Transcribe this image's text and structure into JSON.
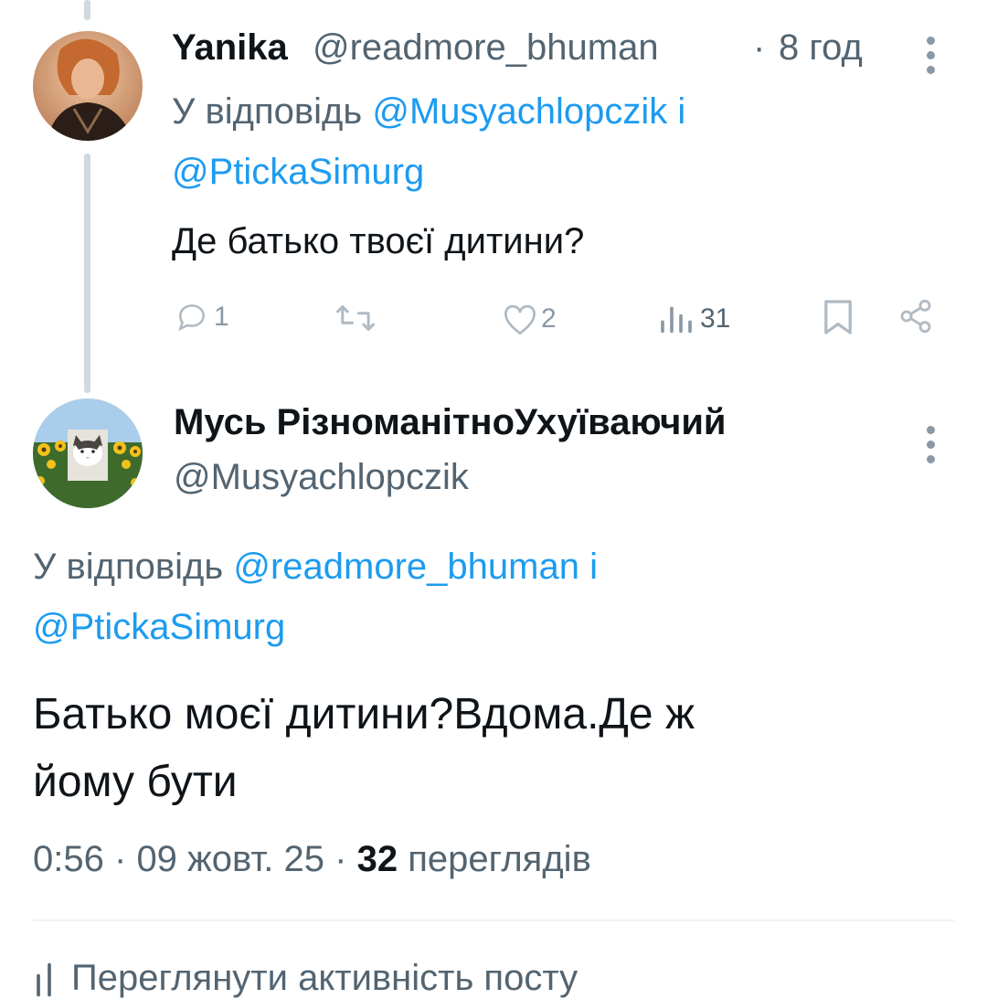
{
  "reply_tweet": {
    "display_name": "Yanika",
    "handle": "@readmore_bhuman",
    "separator": "·",
    "time_ago": "8 год",
    "reply_prefix": "У відповідь",
    "reply_to_1": "@Musyachlopczik",
    "reply_conj": "і",
    "reply_to_2": "@PtickaSimurg",
    "text": "Де батько твоєї дитини?",
    "actions": {
      "replies": "1",
      "retweets": "",
      "likes": "2",
      "views": "31"
    }
  },
  "main_tweet": {
    "display_name": "Мусь РізноманітноУхуїваючий",
    "handle": "@Musyachlopczik",
    "reply_prefix": "У відповідь",
    "reply_to_1": "@readmore_bhuman",
    "reply_conj": "і",
    "reply_to_2": "@PtickaSimurg",
    "text_line1": "Батько моєї дитини?Вдома.Де ж",
    "text_line2": "йому бути",
    "time": "0:56",
    "separator": "·",
    "date": "09 жовт. 25",
    "separator2": "·",
    "views_count": "32",
    "views_label": "переглядів"
  },
  "footer": {
    "activity_label": "Переглянути активність посту"
  },
  "icons": {
    "reply": "reply-icon",
    "retweet": "retweet-icon",
    "like": "like-icon",
    "views": "views-icon",
    "bookmark": "bookmark-icon",
    "share": "share-icon",
    "more": "more-icon"
  },
  "colors": {
    "link": "#1d9bf0",
    "secondary_text": "#536471",
    "primary_text": "#0f1419",
    "thread_line": "#cfd9de"
  }
}
